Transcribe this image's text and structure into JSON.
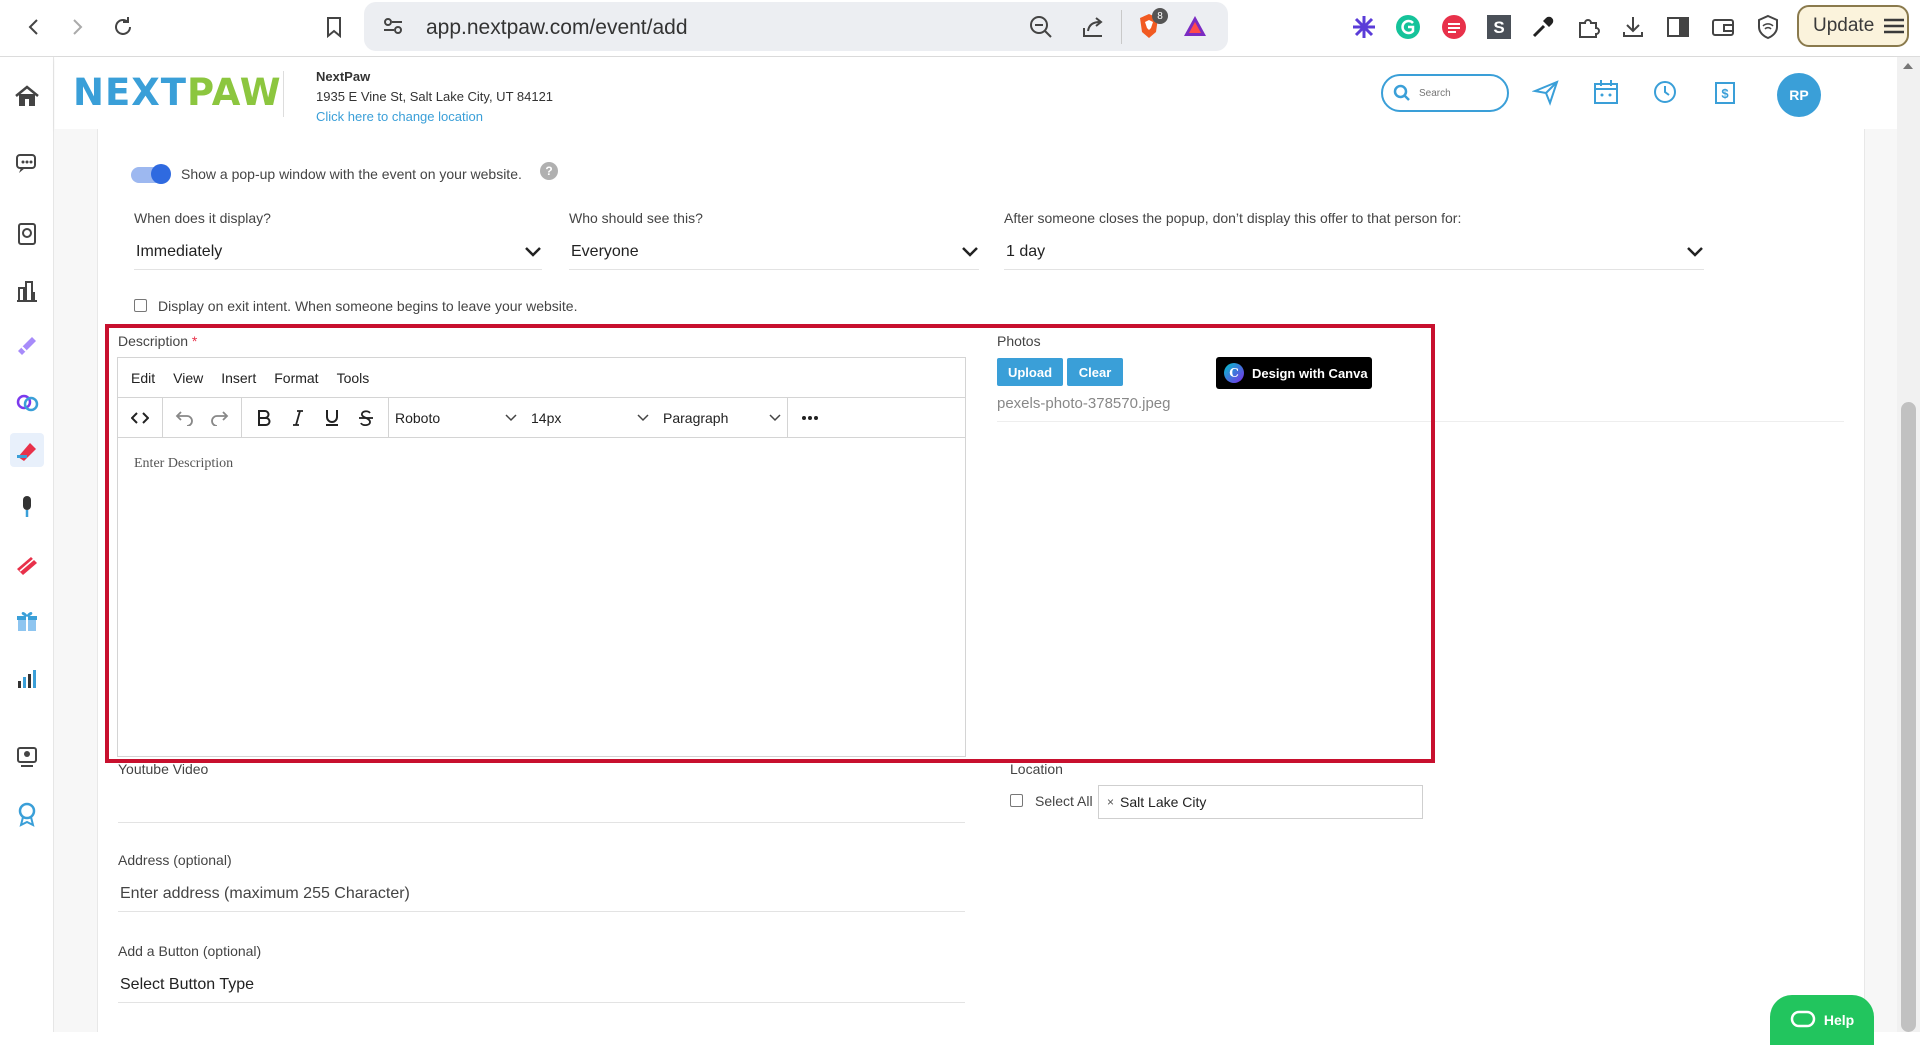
{
  "browser": {
    "url": "app.nextpaw.com/event/add",
    "update_label": "Update",
    "brave_badge": "8"
  },
  "header": {
    "logo_next": "NEXT",
    "logo_paw": "PAW",
    "business_name": "NextPaw",
    "business_address": "1935 E Vine St, Salt Lake City, UT 84121",
    "change_location": "Click here to change location",
    "search_placeholder": "Search",
    "avatar_initials": "RP"
  },
  "popup": {
    "toggle_label": "Show a pop-up window with the event on your website.",
    "toggle_on": true,
    "help_icon": "?",
    "display_label": "When does it display?",
    "display_value": "Immediately",
    "audience_label": "Who should see this?",
    "audience_value": "Everyone",
    "suppress_label": "After someone closes the popup, don’t display this offer to that person for:",
    "suppress_value": "1 day",
    "exit_intent_label": "Display on exit intent. When someone begins to leave your website."
  },
  "description": {
    "label": "Description",
    "required_mark": "*",
    "menu": [
      "Edit",
      "View",
      "Insert",
      "Format",
      "Tools"
    ],
    "font": "Roboto",
    "size": "14px",
    "block": "Paragraph",
    "placeholder": "Enter Description"
  },
  "photos": {
    "label": "Photos",
    "upload_label": "Upload",
    "clear_label": "Clear",
    "canva_label": "Design with Canva",
    "canva_logo": "C",
    "filename": "pexels-photo-378570.jpeg"
  },
  "youtube": {
    "label": "Youtube Video"
  },
  "location": {
    "label": "Location",
    "select_all_label": "Select All",
    "tag_remove": "×",
    "tag": "Salt Lake City"
  },
  "address": {
    "label": "Address (optional)",
    "placeholder": "Enter address (maximum 255 Character)"
  },
  "button_section": {
    "label": "Add a Button (optional)",
    "value": "Select Button Type"
  },
  "help": {
    "label": "Help"
  },
  "colors": {
    "brand_blue": "#3a9fd8",
    "brand_green": "#8cc63f",
    "highlight_red": "#c8102e",
    "help_green": "#22c55e"
  }
}
